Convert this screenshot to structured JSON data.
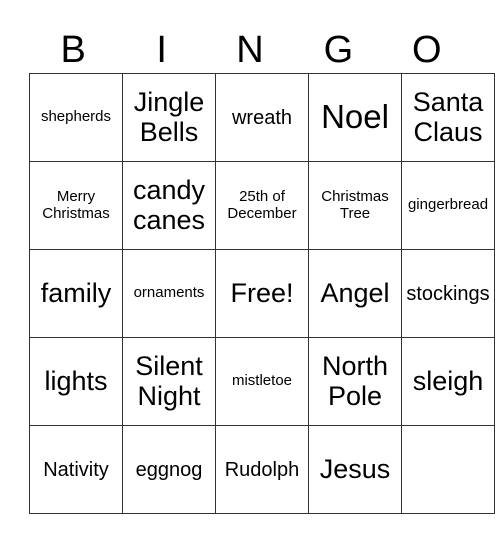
{
  "header": [
    "B",
    "I",
    "N",
    "G",
    "O"
  ],
  "rows": [
    [
      {
        "text": "shepherds",
        "size": "s1"
      },
      {
        "text": "Jingle Bells",
        "size": "s3"
      },
      {
        "text": "wreath",
        "size": "s2"
      },
      {
        "text": "Noel",
        "size": "s4"
      },
      {
        "text": "Santa Claus",
        "size": "s3"
      }
    ],
    [
      {
        "text": "Merry Christmas",
        "size": "s1"
      },
      {
        "text": "candy canes",
        "size": "s3"
      },
      {
        "text": "25th of December",
        "size": "s1"
      },
      {
        "text": "Christmas Tree",
        "size": "s1"
      },
      {
        "text": "gingerbread",
        "size": "s1"
      }
    ],
    [
      {
        "text": "family",
        "size": "s3"
      },
      {
        "text": "ornaments",
        "size": "s1"
      },
      {
        "text": "Free!",
        "size": "s3"
      },
      {
        "text": "Angel",
        "size": "s3"
      },
      {
        "text": "stockings",
        "size": "s2"
      }
    ],
    [
      {
        "text": "lights",
        "size": "s3"
      },
      {
        "text": "Silent Night",
        "size": "s3"
      },
      {
        "text": "mistletoe",
        "size": "s1"
      },
      {
        "text": "North Pole",
        "size": "s3"
      },
      {
        "text": "sleigh",
        "size": "s3"
      }
    ],
    [
      {
        "text": "Nativity",
        "size": "s2"
      },
      {
        "text": "eggnog",
        "size": "s2"
      },
      {
        "text": "Rudolph",
        "size": "s2"
      },
      {
        "text": "Jesus",
        "size": "s3"
      },
      {
        "text": "",
        "size": "s1"
      }
    ]
  ]
}
